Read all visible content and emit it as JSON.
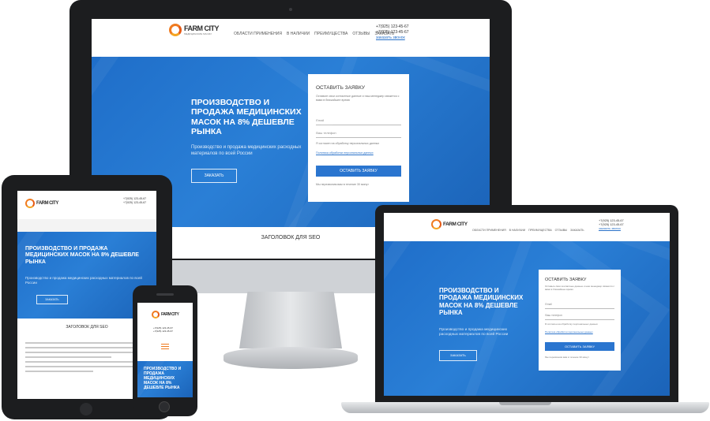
{
  "brand": {
    "logo_text": "FARM CITY",
    "logo_sub": "МЕДИЦИНСКИЕ МАСКИ",
    "logo_orange": "#f07b1f",
    "hero_blue": "#2a7fd6"
  },
  "site": {
    "nav": [
      "ОБЛАСТИ ПРИМЕНЕНИЯ",
      "В НАЛИЧИИ",
      "ПРЕИМУЩЕСТВА",
      "ОТЗЫВЫ",
      "ЗАКАЗАТЬ"
    ],
    "phone1": "+7(925) 123-45-67",
    "phone2": "+7(925) 123-45-67",
    "callback": "заказать звонок",
    "hero_title": "ПРОИЗВОДСТВО И ПРОДАЖА МЕДИЦИНСКИХ МАСОК НА 8% ДЕШЕВЛЕ РЫНКА",
    "hero_sub": "Производство и продажа медицинских расходных материалов по всей России",
    "hero_button": "ЗАКАЗАТЬ",
    "seo_heading": "ЗАГОЛОВОК ДЛЯ SEO"
  },
  "form": {
    "title": "ОСТАВИТЬ ЗАЯВКУ",
    "intro": "Оставьте свои контактные данные и наш менеджер свяжется с вами в ближайшее время",
    "email_label": "Email",
    "phone_label": "Ваш телефон",
    "consent": "Я согласен на обработку персональных данных",
    "policy_link": "Политика обработки персональных данных",
    "submit": "ОСТАВИТЬ ЗАЯВКУ",
    "note": "Мы перезвоним вам в течение 30 минут"
  }
}
